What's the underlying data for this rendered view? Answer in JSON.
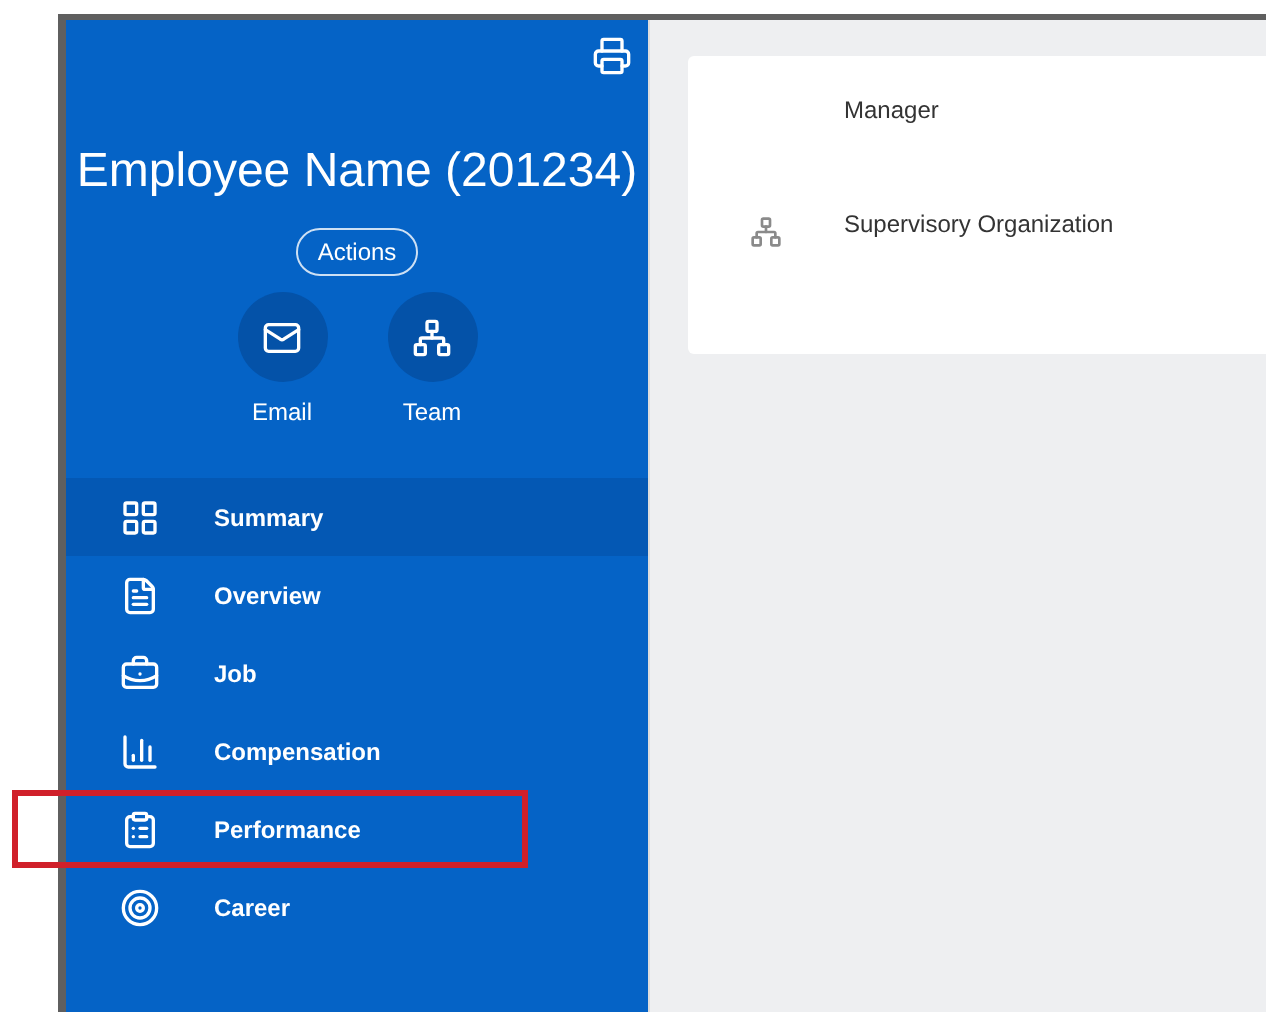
{
  "profile": {
    "name": "Employee Name (201234)",
    "actions_label": "Actions",
    "quick_actions": [
      {
        "kind": "email",
        "label": "Email"
      },
      {
        "kind": "team",
        "label": "Team"
      }
    ]
  },
  "nav": [
    {
      "kind": "summary",
      "label": "Summary",
      "selected": true,
      "highlighted": false
    },
    {
      "kind": "overview",
      "label": "Overview",
      "selected": false,
      "highlighted": false
    },
    {
      "kind": "job",
      "label": "Job",
      "selected": false,
      "highlighted": false
    },
    {
      "kind": "compensation",
      "label": "Compensation",
      "selected": false,
      "highlighted": false
    },
    {
      "kind": "performance",
      "label": "Performance",
      "selected": false,
      "highlighted": true
    },
    {
      "kind": "career",
      "label": "Career",
      "selected": false,
      "highlighted": false
    }
  ],
  "card": {
    "fields": [
      {
        "label": "Manager",
        "icon": false
      },
      {
        "label": "Supervisory Organization",
        "icon": true
      }
    ]
  }
}
